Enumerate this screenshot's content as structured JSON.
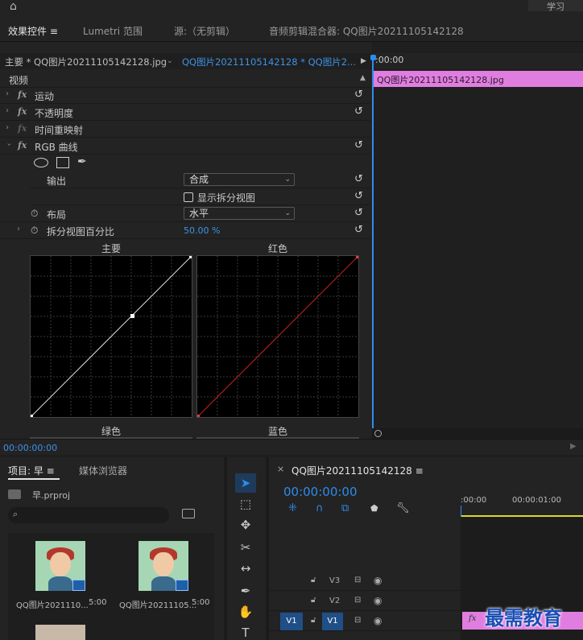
{
  "topbar": {
    "learn_label": "学习"
  },
  "panel_tabs": {
    "effect_controls": "效果控件",
    "lumetri": "Lumetri 范围",
    "source": "源:（无剪辑）",
    "audio_mixer": "音频剪辑混合器: QQ图片20211105142128"
  },
  "clipbar": {
    "master": "主要 * QQ图片20211105142128.jpg",
    "clip": "QQ图片20211105142128 * QQ图片2..."
  },
  "effects": {
    "section": "视频",
    "motion": "运动",
    "opacity": "不透明度",
    "time_remap": "时间重映射",
    "rgb_curves": "RGB 曲线",
    "output_label": "输出",
    "output_value": "合成",
    "split_view_label": "显示拆分视图",
    "layout_label": "布局",
    "layout_value": "水平",
    "split_pct_label": "拆分视图百分比",
    "split_pct_value": "50.00 %"
  },
  "curves": {
    "master": "主要",
    "red": "红色",
    "green": "绿色",
    "blue": "蓝色"
  },
  "timeline_right": {
    "timecode": ":00:00",
    "clip_name": "QQ图片20211105142128.jpg"
  },
  "statusbar": {
    "timecode": "00:00:00:00"
  },
  "project": {
    "tab_project": "项目: 早",
    "tab_media": "媒体浏览器",
    "file": "早.prproj",
    "items": [
      {
        "name": "QQ图片2021110...",
        "duration": "5:00"
      },
      {
        "name": "QQ图片20211105...",
        "duration": "5:00"
      }
    ]
  },
  "sequence": {
    "title": "QQ图片20211105142128",
    "timecode": "00:00:00:00",
    "ruler": [
      ":00:00",
      "00:00:01:00"
    ],
    "tracks": [
      {
        "name": "V3"
      },
      {
        "name": "V2"
      },
      {
        "name": "V1",
        "source": "V1"
      }
    ]
  },
  "watermark": "最需教育",
  "colors": {
    "accent": "#2d8ceb",
    "clip_pink": "#e07ee0",
    "red_curve": "#b01c1c"
  }
}
